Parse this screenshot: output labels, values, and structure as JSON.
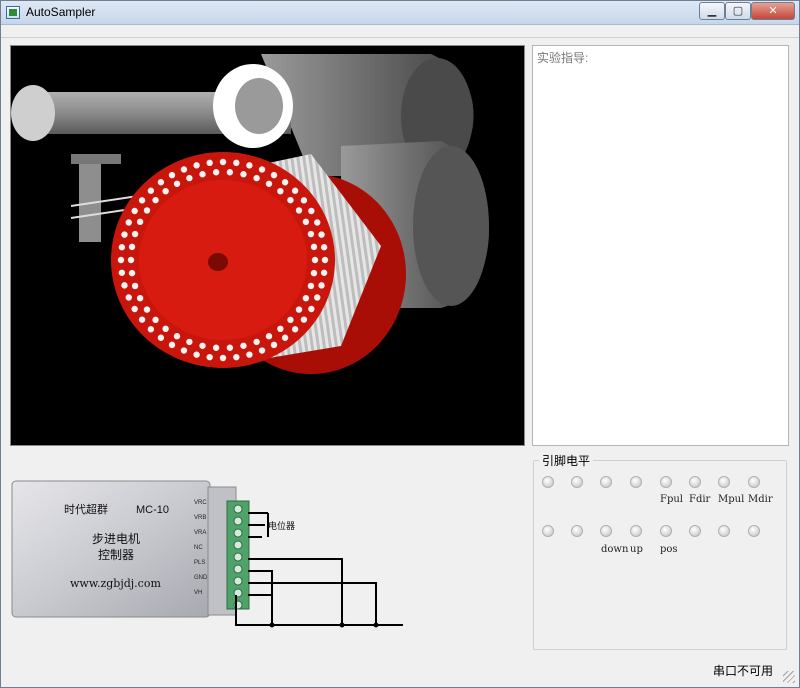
{
  "window": {
    "title": "AutoSampler",
    "buttons": {
      "minimize": "▁",
      "maximize": "▢",
      "close": "✕"
    }
  },
  "guide": {
    "label": "实验指导:"
  },
  "controller": {
    "brand": "时代超群",
    "model": "MC-10",
    "name_line1": "步进电机",
    "name_line2": "控制器",
    "website": "www.zgbjdj.com",
    "terminals": [
      "VRC",
      "VRB",
      "VRA",
      "NC",
      "PLS",
      "GND",
      "VH"
    ],
    "potentiometer_label": "电位器"
  },
  "pins": {
    "group_title": "引脚电平",
    "row1_labels": [
      "Fpul",
      "Fdir",
      "Mpul",
      "Mdir"
    ],
    "row2_labels": [
      "down",
      "up",
      "pos"
    ]
  },
  "status": {
    "text": "串口不可用"
  },
  "colors": {
    "drum": "#c8160c",
    "background": "#000000"
  }
}
